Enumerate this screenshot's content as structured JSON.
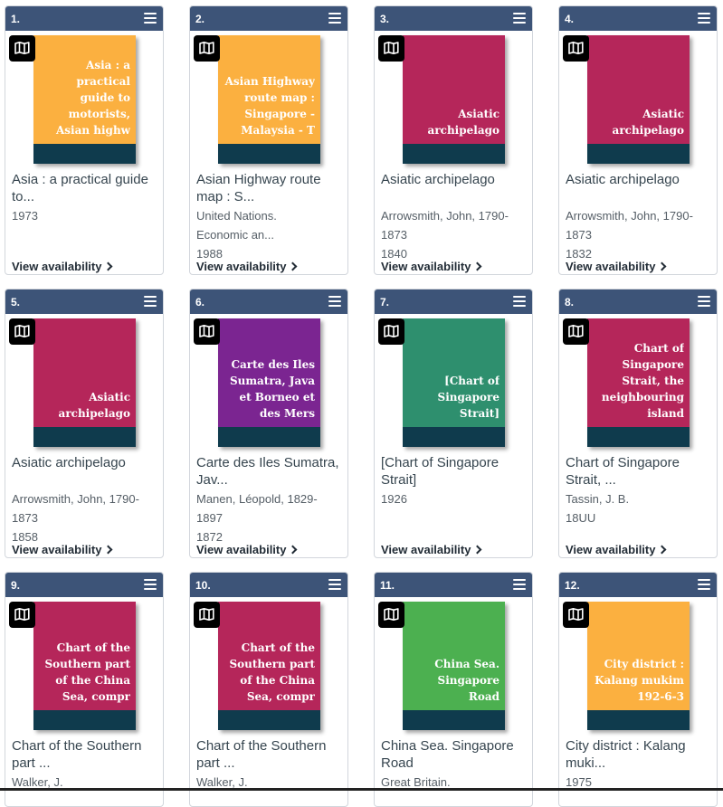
{
  "actions": {
    "view_availability": "View availability"
  },
  "colors": {
    "header": "#3d5478",
    "cover_strip": "#0f3b4d",
    "orange": "#fbb040",
    "crimson": "#b5265a",
    "purple": "#7b2591",
    "teal": "#2e8f6e",
    "green": "#4cb050"
  },
  "cards": [
    {
      "num": "1.",
      "cover_color": "#fbb040",
      "cover_text": "Asia : a practical guide to motorists, Asian highw",
      "title": "Asia : a practical guide to...",
      "meta": [
        "1973"
      ]
    },
    {
      "num": "2.",
      "cover_color": "#fbb040",
      "cover_text": "Asian Highway route map : Singapore - Malaysia - T",
      "title": "Asian Highway route map : S...",
      "meta": [
        "United Nations.",
        "Economic an...",
        "1988"
      ]
    },
    {
      "num": "3.",
      "cover_color": "#b5265a",
      "cover_text": "Asiatic archipelago",
      "title": "Asiatic archipelago",
      "meta": [
        "Arrowsmith, John, 1790-",
        "1873",
        "1840"
      ]
    },
    {
      "num": "4.",
      "cover_color": "#b5265a",
      "cover_text": "Asiatic archipelago",
      "title": "Asiatic archipelago",
      "meta": [
        "Arrowsmith, John, 1790-",
        "1873",
        "1832"
      ]
    },
    {
      "num": "5.",
      "cover_color": "#b5265a",
      "cover_text": "Asiatic archipelago",
      "title": "Asiatic archipelago",
      "meta": [
        "Arrowsmith, John, 1790-",
        "1873",
        "1858"
      ]
    },
    {
      "num": "6.",
      "cover_color": "#7b2591",
      "cover_text": "Carte des Iles Sumatra, Java et Borneo et des Mers",
      "title": "Carte des Iles Sumatra, Jav...",
      "meta": [
        "Manen, Léopold, 1829-",
        "1897",
        "1872"
      ]
    },
    {
      "num": "7.",
      "cover_color": "#2e8f6e",
      "cover_text": "[Chart of Singapore Strait]",
      "title": "[Chart of Singapore Strait]",
      "meta": [
        "1926"
      ]
    },
    {
      "num": "8.",
      "cover_color": "#b5265a",
      "cover_text": "Chart of Singapore Strait, the neighbouring island",
      "title": "Chart of Singapore Strait, ...",
      "meta": [
        "Tassin, J. B.",
        "18UU"
      ]
    },
    {
      "num": "9.",
      "cover_color": "#b5265a",
      "cover_text": "Chart of the Southern part of the China Sea, compr",
      "title": "Chart of the Southern part ...",
      "meta": [
        "Walker, J."
      ]
    },
    {
      "num": "10.",
      "cover_color": "#b5265a",
      "cover_text": "Chart of the Southern part of the China Sea, compr",
      "title": "Chart of the Southern part ...",
      "meta": [
        "Walker, J."
      ]
    },
    {
      "num": "11.",
      "cover_color": "#4cb050",
      "cover_text": "China Sea. Singapore Road",
      "title": "China Sea. Singapore Road",
      "meta": [
        "Great Britain."
      ]
    },
    {
      "num": "12.",
      "cover_color": "#fbb040",
      "cover_text": "City district : Kalang mukim 192-6-3",
      "title": "City district : Kalang muki...",
      "meta": [
        "1975"
      ]
    }
  ]
}
